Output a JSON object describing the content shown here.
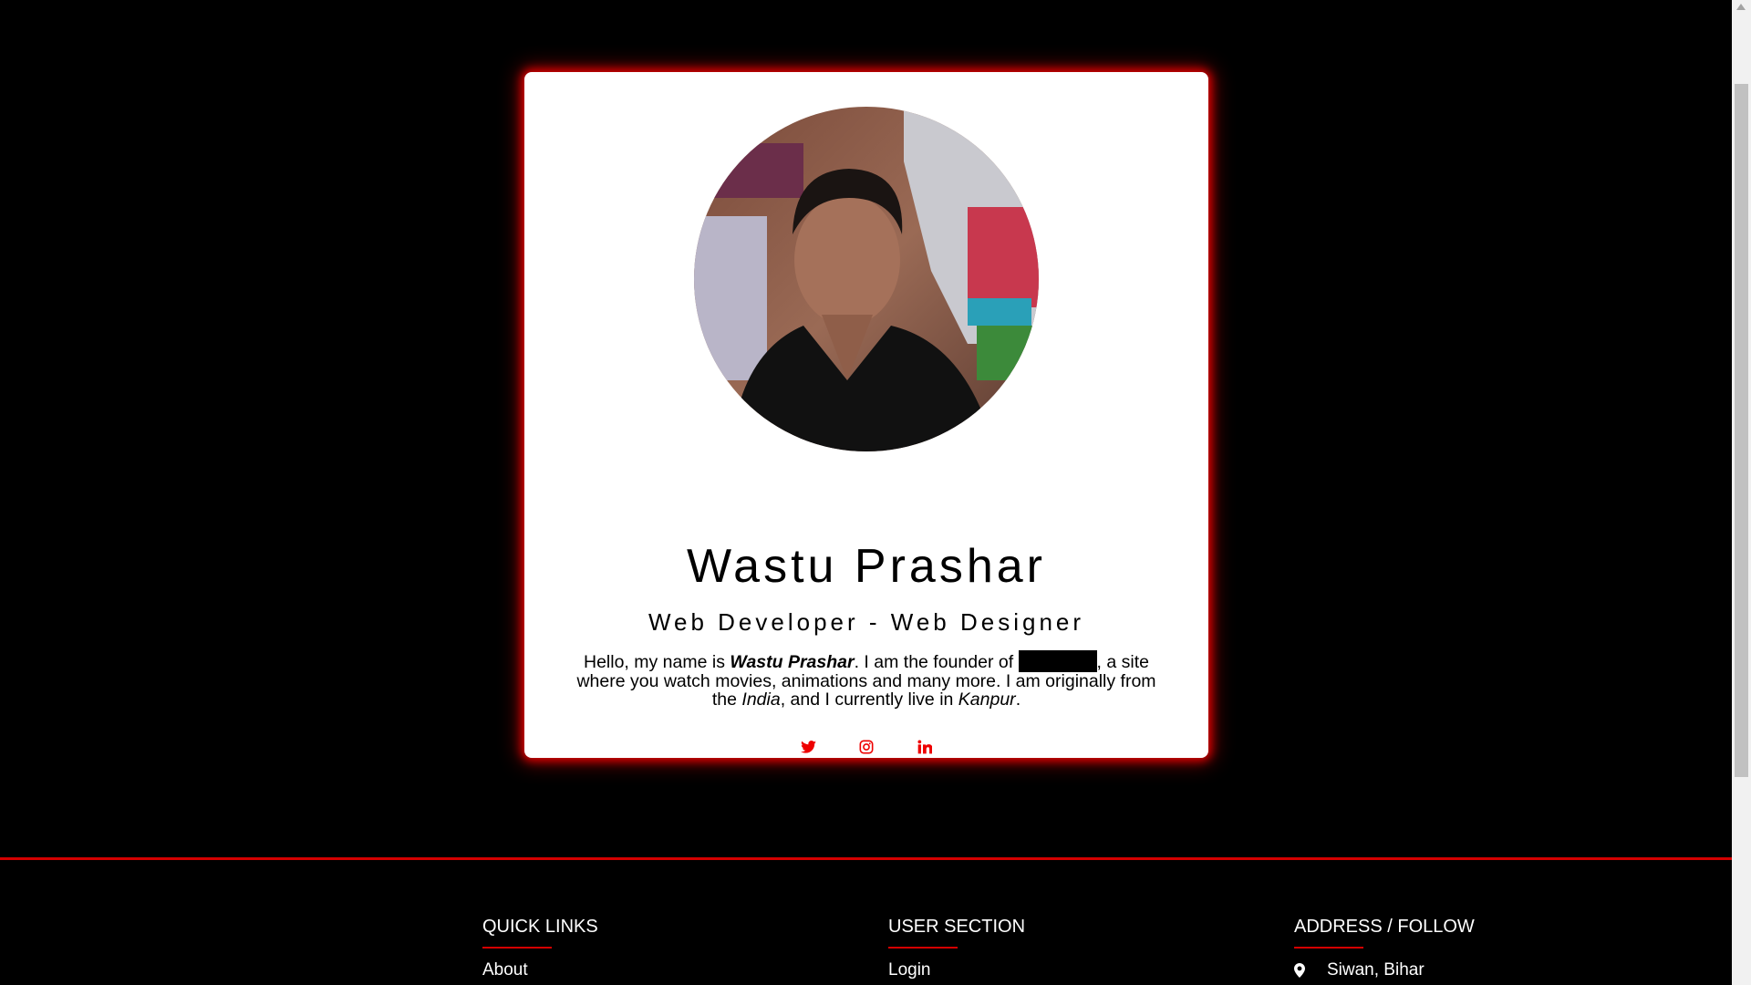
{
  "profile": {
    "name": "Wastu Prashar",
    "role": "Web Developer - Web Designer",
    "bio": {
      "intro": "Hello, my name is ",
      "name_bold": "Wastu Prashar",
      "founder_text": ". I am the founder of ",
      "site_text": ", a site where you watch movies, animations and many more. I am originally from the ",
      "country": "India",
      "live_text": ", and I currently live in ",
      "city": "Kanpur",
      "end": "."
    },
    "socials": [
      {
        "icon": "twitter-icon"
      },
      {
        "icon": "instagram-icon"
      },
      {
        "icon": "linkedin-icon"
      }
    ],
    "accent_color": "#e00000"
  },
  "footer": {
    "quick_links": {
      "title": "QUICK LINKS",
      "items": [
        "About"
      ]
    },
    "user_section": {
      "title": "USER SECTION",
      "items": [
        "Login"
      ]
    },
    "address": {
      "title": "ADDRESS / FOLLOW",
      "location": "Siwan, Bihar",
      "icon": "map-marker-icon"
    }
  }
}
